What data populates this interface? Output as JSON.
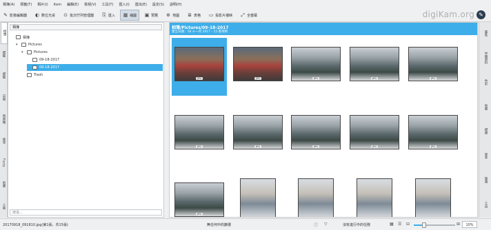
{
  "menubar": {
    "items": [
      "相簿(A)",
      "標籤(T)",
      "相片(I)",
      "Item",
      "編輯(E)",
      "檢視(V)",
      "工具(T)",
      "匯入(I)",
      "匯出(E)",
      "設定(S)",
      "說明(H)"
    ]
  },
  "toolbar": {
    "buttons": [
      {
        "label": "影像編輯器",
        "icon": "pencil-icon"
      },
      {
        "label": "數位光桌",
        "icon": "light-table-icon"
      },
      {
        "label": "批次佇列管理器",
        "icon": "queue-icon"
      },
      {
        "label": "匯入",
        "icon": "import-icon"
      },
      {
        "label": "縮圖",
        "icon": "thumbnails-icon",
        "active": true
      },
      {
        "label": "預覽",
        "icon": "preview-icon"
      },
      {
        "label": "地圖",
        "icon": "map-icon"
      },
      {
        "label": "表格",
        "icon": "table-icon"
      },
      {
        "label": "投影片播映",
        "icon": "slideshow-icon"
      },
      {
        "label": "全螢幕",
        "icon": "fullscreen-icon"
      }
    ],
    "brand": "digiKam.org"
  },
  "left_tabs": [
    "相簿",
    "標籤",
    "標籤",
    "日曆",
    "時間軸",
    "搜尋",
    "Fuzzy",
    "地圖",
    "人臉"
  ],
  "left_panel": {
    "header": "相簿",
    "tree": [
      {
        "label": "相簿",
        "level": 0,
        "arrow": ""
      },
      {
        "label": "Pictures",
        "level": 1,
        "arrow": "▾"
      },
      {
        "label": "Pictures",
        "level": 2,
        "arrow": "▾"
      },
      {
        "label": "09-18-2017",
        "level": 3,
        "arrow": ""
      },
      {
        "label": "09-18-2017",
        "level": 3,
        "arrow": "",
        "selected": true
      },
      {
        "label": "Trash",
        "level": 2,
        "arrow": ""
      }
    ],
    "search_placeholder": "搜尋..."
  },
  "album": {
    "title": "相簿/Pictures/09-18-2017",
    "subtitle": "建立日期：18 十一月 2017 - 15 張項目"
  },
  "thumbs": [
    {
      "badge": "JPG",
      "selected": true,
      "scene": "auditorium"
    },
    {
      "badge": "JPG",
      "scene": "auditorium"
    },
    {
      "badge": "JPG",
      "scene": "classroom"
    },
    {
      "badge": "JPG",
      "scene": "classroom"
    },
    {
      "badge": "JPG",
      "scene": "classroom"
    },
    {
      "badge": "JPG",
      "scene": "classroom"
    },
    {
      "badge": "JPG",
      "scene": "classroom"
    },
    {
      "badge": "JPG",
      "scene": "classroom"
    },
    {
      "badge": "JPG",
      "scene": "classroom"
    },
    {
      "badge": "JPG",
      "scene": "classroom"
    },
    {
      "badge": "JPG",
      "scene": "classroom"
    },
    {
      "badge": "JPG",
      "scene": "portrait"
    },
    {
      "badge": "JPG",
      "scene": "portrait"
    },
    {
      "badge": "JPG",
      "scene": "portrait"
    },
    {
      "badge": "JPG",
      "scene": "portrait"
    }
  ],
  "right_tabs": [
    "屬性",
    "中繼資料",
    "色彩",
    "地圖",
    "標題",
    "版本",
    "篩選",
    "工具"
  ],
  "statusbar": {
    "file": "20170918_091810.jpg(第1張，共15張)",
    "filter": "無任何中的篩選",
    "pending": "沒有進行中的任務",
    "zoom_value": "10%",
    "zoom_fraction": 0.25
  },
  "colors": {
    "accent": "#3daee9"
  }
}
